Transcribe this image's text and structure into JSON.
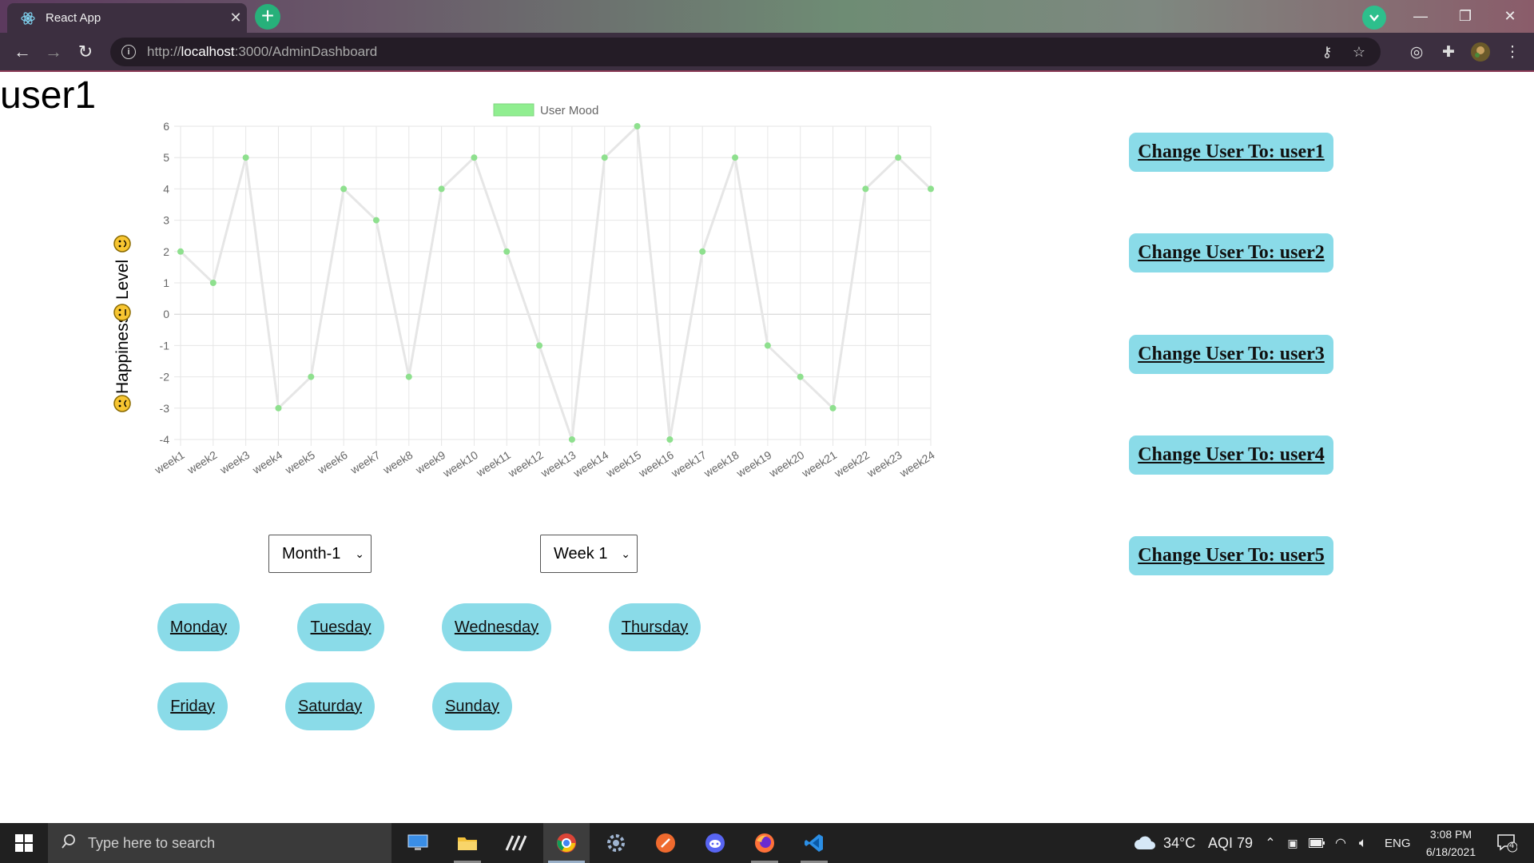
{
  "browser": {
    "tab_title": "React App",
    "url_prefix": "http://",
    "url_host": "localhost",
    "url_path": ":3000/AdminDashboard"
  },
  "page": {
    "user_heading": "user1",
    "month_select": "Month-1",
    "week_select": "Week 1",
    "days": [
      "Monday",
      "Tuesday",
      "Wednesday",
      "Thursday",
      "Friday",
      "Saturday",
      "Sunday"
    ],
    "user_buttons": [
      "Change User To: user1",
      "Change User To: user2",
      "Change User To: user3",
      "Change User To: user4",
      "Change User To: user5"
    ]
  },
  "chart_data": {
    "type": "line",
    "legend": "User Mood",
    "legend_position": "top",
    "ylabel_parts": [
      "Happiness",
      "Level"
    ],
    "categories": [
      "week1",
      "week2",
      "week3",
      "week4",
      "week5",
      "week6",
      "week7",
      "week8",
      "week9",
      "week10",
      "week11",
      "week12",
      "week13",
      "week14",
      "week15",
      "week16",
      "week17",
      "week18",
      "week19",
      "week20",
      "week21",
      "week22",
      "week23",
      "week24"
    ],
    "series": [
      {
        "name": "User Mood",
        "values": [
          2,
          1,
          5,
          -3,
          -2,
          4,
          3,
          -2,
          4,
          5,
          2,
          -1,
          -4,
          5,
          6,
          -4,
          2,
          5,
          -1,
          -2,
          -3,
          4,
          5,
          4
        ]
      }
    ],
    "ylim": [
      -4,
      6
    ],
    "yticks": [
      -4,
      -3,
      -2,
      -1,
      0,
      1,
      2,
      3,
      4,
      5,
      6
    ],
    "grid": true,
    "colors": {
      "line": "#e6e6e6",
      "point": "#8ee08e",
      "legend_box": "#90ee90"
    }
  },
  "taskbar": {
    "search_placeholder": "Type here to search",
    "weather": "34°C",
    "aqi": "AQI 79",
    "language": "ENG",
    "time": "3:08 PM",
    "date": "6/18/2021",
    "notifications": "4"
  }
}
